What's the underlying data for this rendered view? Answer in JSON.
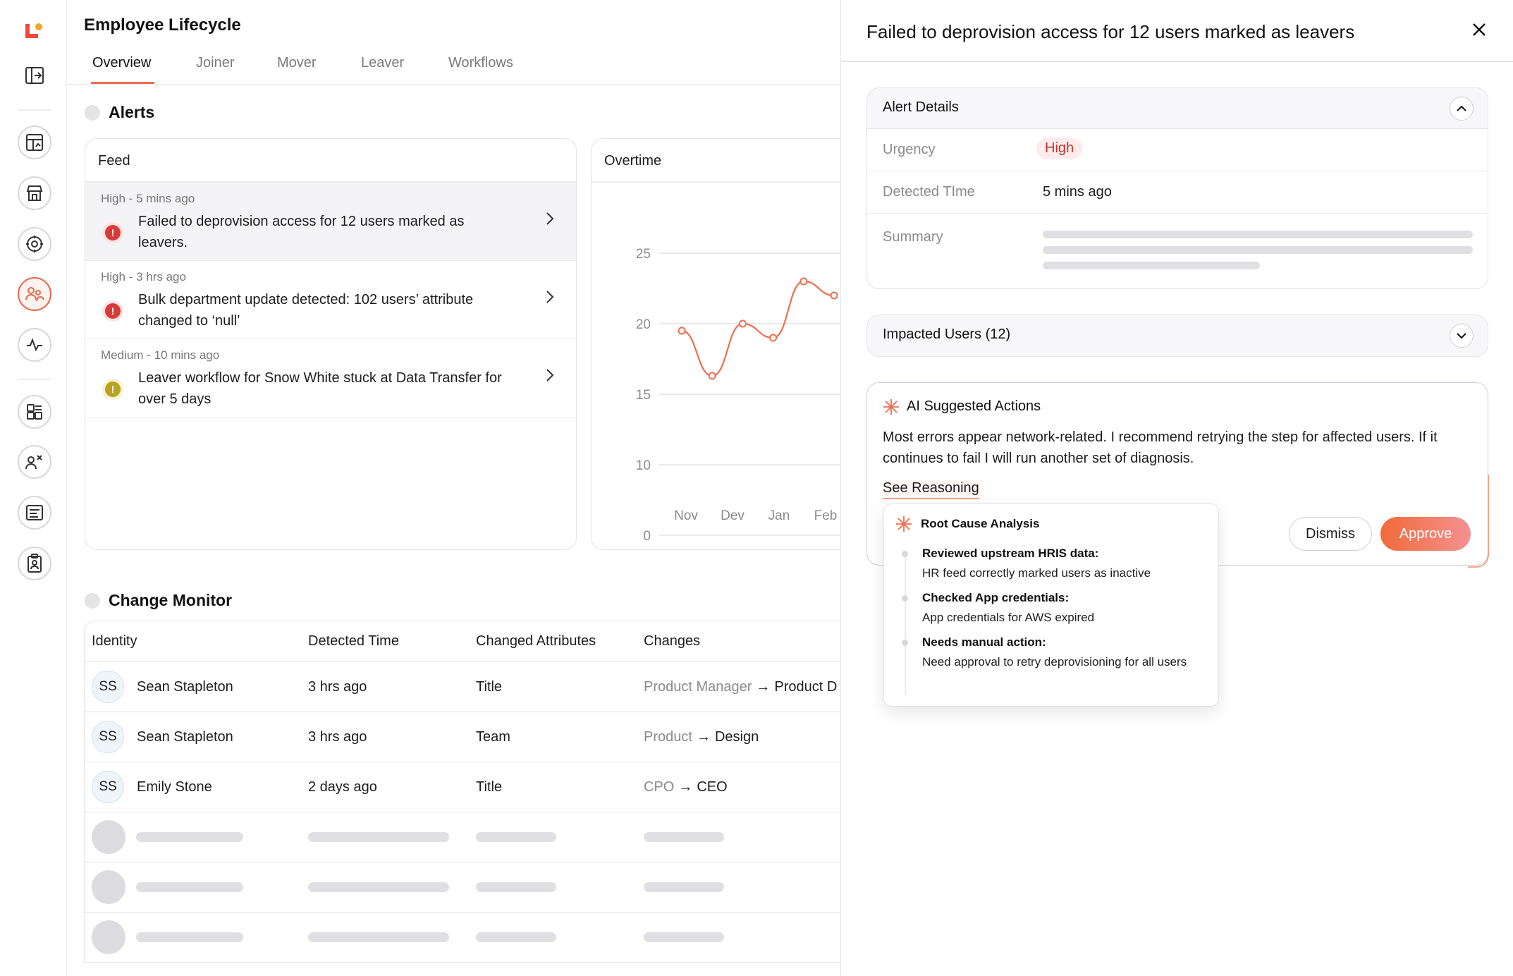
{
  "app": {
    "title": "Employee Lifecycle"
  },
  "tabs": [
    {
      "label": "Overview",
      "active": true
    },
    {
      "label": "Joiner"
    },
    {
      "label": "Mover"
    },
    {
      "label": "Leaver"
    },
    {
      "label": "Workflows"
    }
  ],
  "rail_icons": [
    "logo",
    "collapse-icon",
    "dashboard-icon",
    "store-icon",
    "shield-icon",
    "users-icon",
    "activity-icon",
    "apps-icon",
    "user-x-icon",
    "list-icon",
    "badge-icon"
  ],
  "alerts": {
    "heading": "Alerts",
    "feed": {
      "title": "Feed",
      "items": [
        {
          "meta": "High - 5 mins ago",
          "text": "Failed to deprovision access for 12 users marked as leavers.",
          "severity": "high"
        },
        {
          "meta": "High - 3 hrs ago",
          "text": "Bulk department update detected: 102 users’ attribute changed to ‘null’",
          "severity": "high"
        },
        {
          "meta": "Medium - 10 mins ago",
          "text": "Leaver workflow for Snow White stuck at Data Transfer for over 5 days",
          "severity": "medium"
        }
      ]
    },
    "overtime": {
      "title": "Overtime"
    }
  },
  "chart_data": {
    "type": "line",
    "title": "Overtime",
    "categories": [
      "Nov",
      "Dev",
      "Jan",
      "Feb"
    ],
    "yticks": [
      0,
      10,
      15,
      20,
      25
    ],
    "ylim": [
      5,
      27
    ],
    "series": [
      {
        "values": [
          19.5,
          16.3,
          20,
          19,
          23,
          22
        ]
      }
    ],
    "x_positions": [
      0.0,
      0.6,
      1.2,
      1.8,
      2.4,
      3.0
    ],
    "color": "#ef6c4d"
  },
  "change_monitor": {
    "heading": "Change Monitor",
    "columns": [
      "Identity",
      "Detected Time",
      "Changed Attributes",
      "Changes"
    ],
    "rows": [
      {
        "initials": "SS",
        "name": "Sean Stapleton",
        "time": "3 hrs ago",
        "attr": "Title",
        "from": "Product Manager",
        "to": "Product D"
      },
      {
        "initials": "SS",
        "name": "Sean Stapleton",
        "time": "3 hrs ago",
        "attr": "Team",
        "from": "Product",
        "to": "Design"
      },
      {
        "initials": "SS",
        "name": "Emily Stone",
        "time": "2 days ago",
        "attr": "Title",
        "from": "CPO",
        "to": "CEO"
      }
    ],
    "arrow": "→"
  },
  "panel": {
    "title": "Failed to deprovision access for 12 users marked as leavers",
    "alert_details": {
      "title": "Alert Details",
      "urgency_label": "Urgency",
      "urgency_value": "High",
      "detected_label": "Detected TIme",
      "detected_value": "5 mins ago",
      "summary_label": "Summary"
    },
    "impacted": {
      "title": "Impacted Users (12)"
    },
    "ai": {
      "title": "AI Suggested Actions",
      "body": "Most errors appear network-related. I recommend retrying the step for affected users. If it continues to fail I will run another set of diagnosis.",
      "link": "See Reasoning",
      "dismiss": "Dismiss",
      "approve": "Approve"
    },
    "rca": {
      "title": "Root Cause Analysis",
      "steps": [
        {
          "h": "Reviewed upstream HRIS data:",
          "p": "HR feed correctly marked users as inactive"
        },
        {
          "h": "Checked App credentials:",
          "p": "App credentials for AWS expired"
        },
        {
          "h": "Needs manual action:",
          "p": "Need approval to retry deprovisioning for all users"
        }
      ]
    }
  }
}
